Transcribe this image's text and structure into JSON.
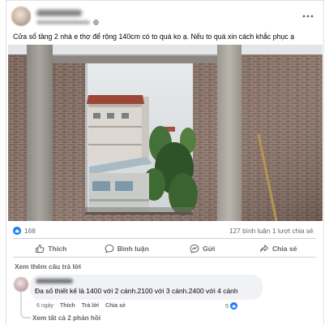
{
  "post": {
    "privacy_icon": "globe-icon",
    "more_icon": "more-horizontal-icon",
    "text": "Cửa sổ tầng 2 nhà e thợ để rộng 140cm có to quá ko ạ. Nếu to quá xin cách khắc  phục ạ"
  },
  "stats": {
    "reaction_icon": "like-reaction-icon",
    "reactions_count": "168",
    "comments": "127 bình luận",
    "shares": "1 lượt chia sẻ"
  },
  "actions": [
    {
      "label": "Thích",
      "icon": "thumbs-up-icon"
    },
    {
      "label": "Bình luận",
      "icon": "comment-icon"
    },
    {
      "label": "Gửi",
      "icon": "messenger-send-icon"
    },
    {
      "label": "Chia sẻ",
      "icon": "share-icon"
    }
  ],
  "comments": {
    "view_more": "Xem thêm câu trả lời",
    "items": [
      {
        "text": "Đa số thiết kế là 1400 với 2 cánh.2100 với 3 cánh.2400 với 4 cánh",
        "time": "6 ngày",
        "like_label": "Thích",
        "reply_label": "Trả lời",
        "share_label": "Chia sẻ",
        "reaction_count": "5",
        "reaction_icon": "like-reaction-icon",
        "view_replies": "Xem tất cả 2 phản hồi"
      }
    ]
  },
  "colors": {
    "accent": "#1877f2",
    "text": "#050505",
    "muted": "#65676b",
    "bubble": "#f0f2f5",
    "divider": "#ced0d4"
  }
}
